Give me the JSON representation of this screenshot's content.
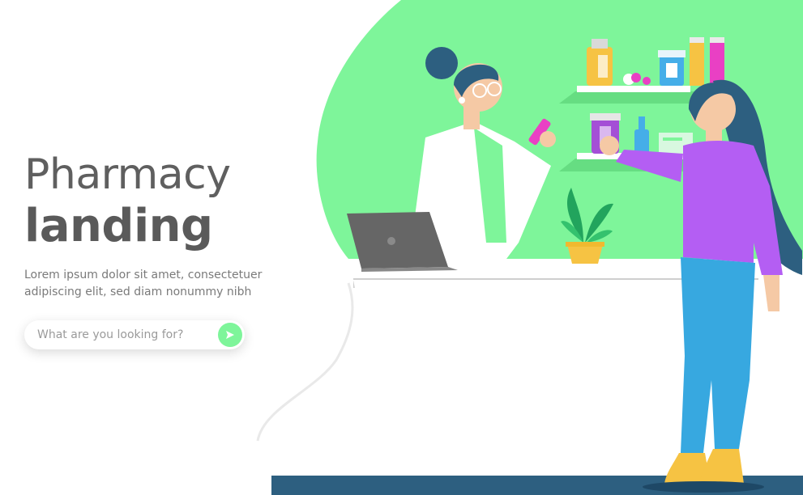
{
  "hero": {
    "title_light": "Pharmacy",
    "title_bold": "landing",
    "subtitle": "Lorem ipsum dolor sit amet, consectetuer adipiscing elit, sed diam nonummy nibh"
  },
  "search": {
    "placeholder": "What are you looking for?",
    "button_icon": "send-arrow-icon"
  },
  "colors": {
    "accent_green": "#7ef59a",
    "floor_navy": "#2d5f80",
    "purple": "#b45ef3",
    "blue_jeans": "#37a8e0",
    "heading_gray": "#5a5a5a"
  }
}
